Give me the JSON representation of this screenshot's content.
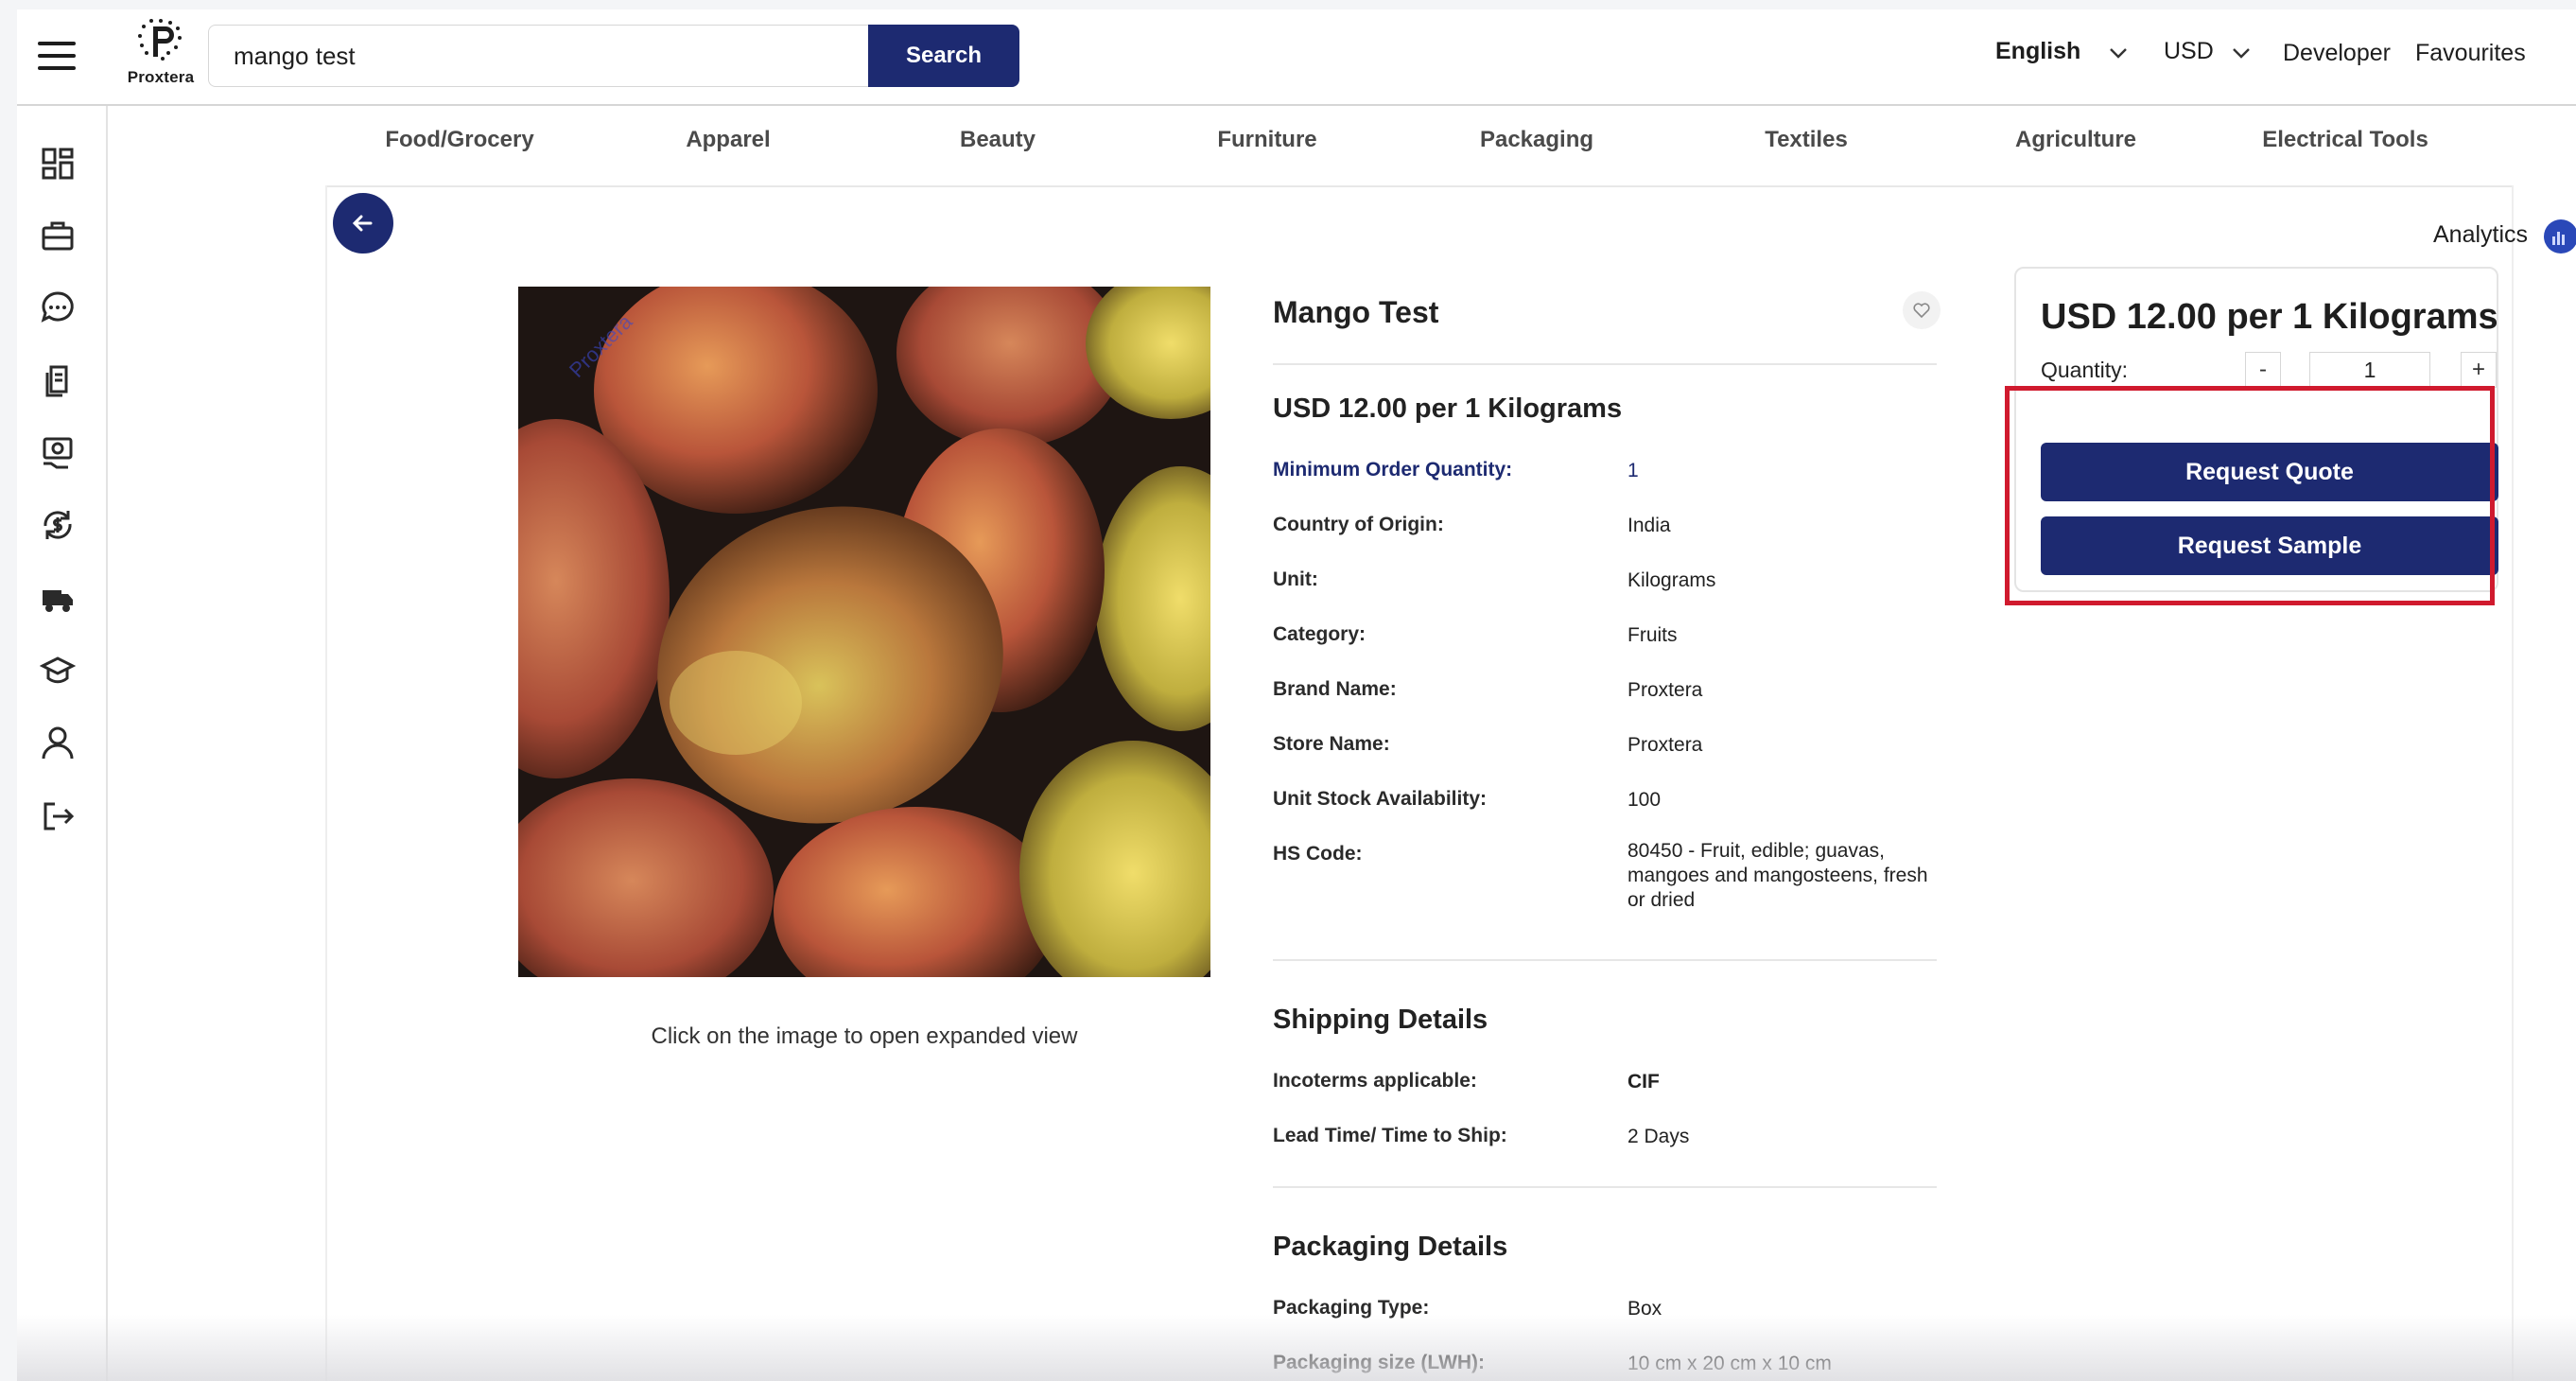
{
  "header": {
    "logo_text": "Proxtera",
    "search_value": "mango test",
    "search_button": "Search",
    "language": "English",
    "currency": "USD",
    "developer": "Developer",
    "favourites": "Favourites"
  },
  "sidebar": {
    "icons": [
      "dashboard-icon",
      "briefcase-icon",
      "chat-icon",
      "documents-icon",
      "payments-icon",
      "refresh-dollar-icon",
      "truck-icon",
      "graduation-cap-icon",
      "user-icon",
      "logout-icon"
    ]
  },
  "categories": [
    "Food/Grocery",
    "Apparel",
    "Beauty",
    "Furniture",
    "Packaging",
    "Textiles",
    "Agriculture",
    "Electrical Tools"
  ],
  "analytics_label": "Analytics",
  "product": {
    "title": "Mango Test",
    "price": "USD 12.00 per 1 Kilograms",
    "image_caption": "Click on the image to open expanded view",
    "watermark": "Proxtera",
    "attributes": [
      {
        "label": "Minimum Order Quantity:",
        "value": "1"
      },
      {
        "label": "Country of Origin:",
        "value": "India"
      },
      {
        "label": "Unit:",
        "value": "Kilograms"
      },
      {
        "label": "Category:",
        "value": "Fruits"
      },
      {
        "label": "Brand Name:",
        "value": "Proxtera"
      },
      {
        "label": "Store Name:",
        "value": "Proxtera"
      },
      {
        "label": "Unit Stock Availability:",
        "value": "100"
      },
      {
        "label": "HS Code:",
        "value": "80450 - Fruit, edible; guavas, mangoes and mangosteens, fresh or dried"
      }
    ],
    "shipping": {
      "title": "Shipping Details",
      "rows": [
        {
          "label": "Incoterms applicable:",
          "value": "CIF"
        },
        {
          "label": "Lead Time/ Time to Ship:",
          "value": "2 Days"
        }
      ]
    },
    "packaging": {
      "title": "Packaging Details",
      "rows": [
        {
          "label": "Packaging Type:",
          "value": "Box"
        },
        {
          "label": "Packaging size (LWH):",
          "value": "10 cm x 20 cm x 10 cm"
        }
      ]
    }
  },
  "price_card": {
    "price": "USD 12.00 per 1 Kilograms",
    "quantity_label": "Quantity:",
    "quantity_value": "1",
    "minus": "-",
    "plus": "+",
    "request_quote": "Request Quote",
    "request_sample": "Request Sample"
  },
  "colors": {
    "brand_navy": "#1d2a71",
    "highlight_red": "#d01a2e"
  }
}
